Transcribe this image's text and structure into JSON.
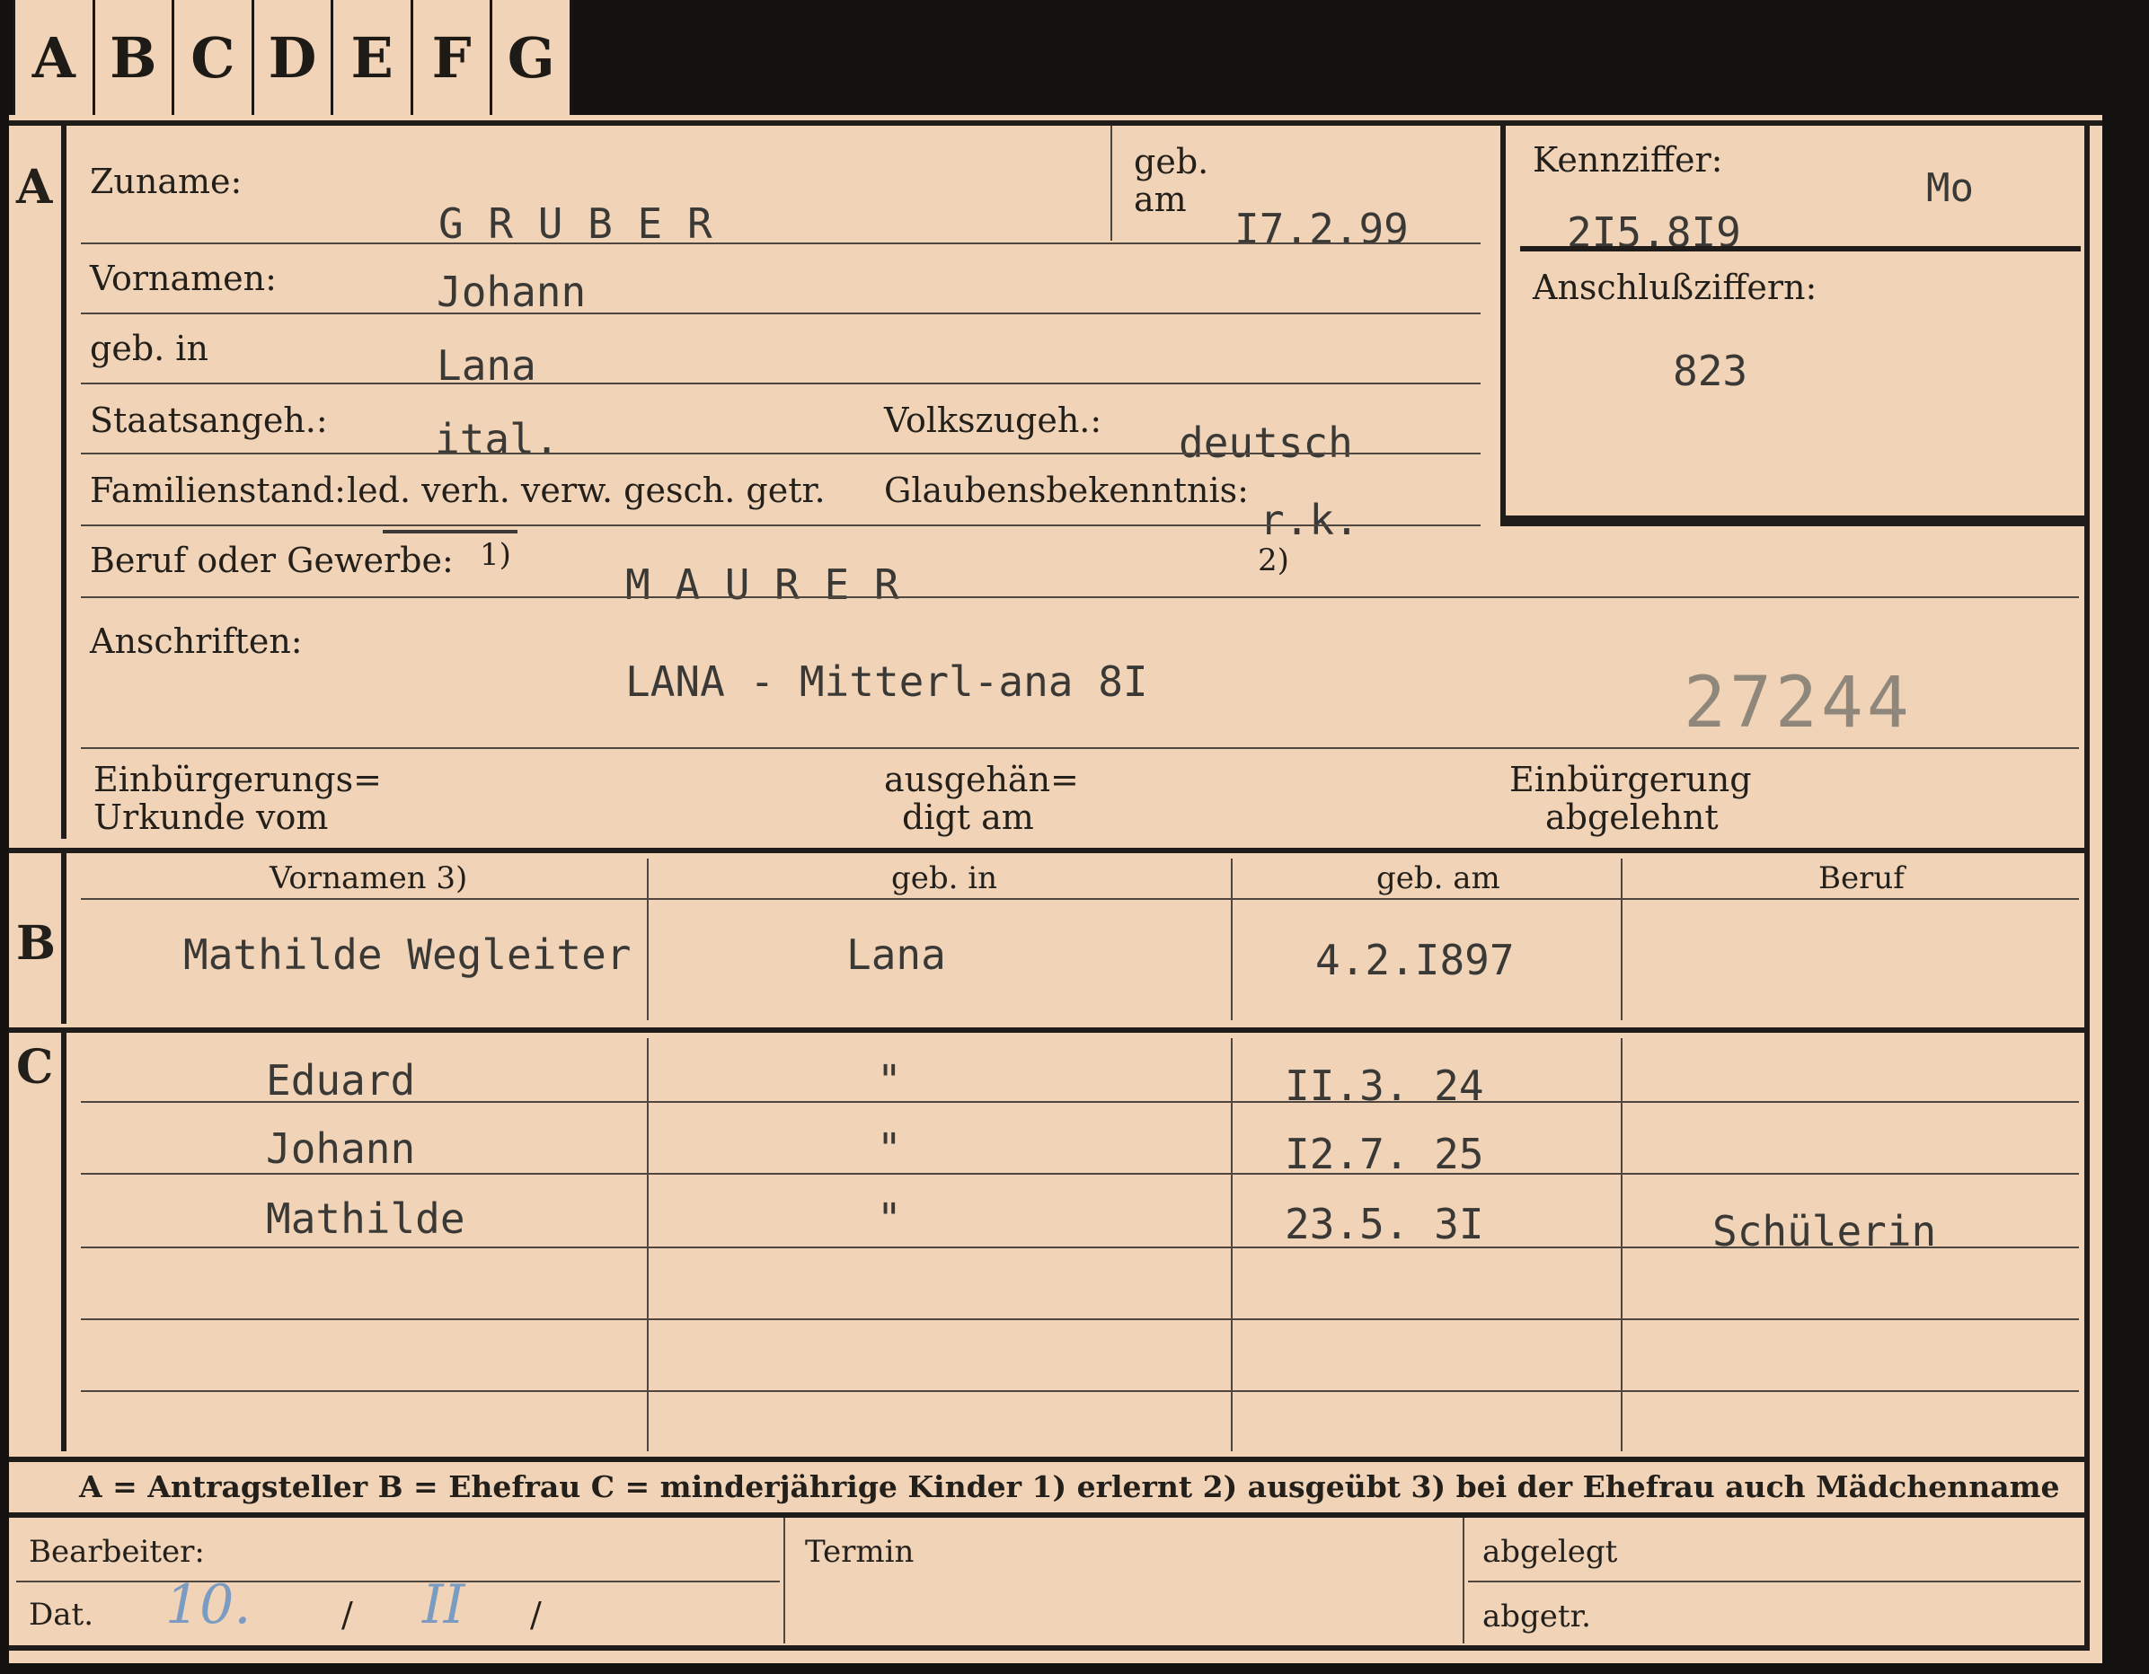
{
  "tabs": [
    "A",
    "B",
    "C",
    "D",
    "E",
    "F",
    "G"
  ],
  "section_a": {
    "marker": "A",
    "zuname_label": "Zuname:",
    "zuname_value": "G R U B E R",
    "geb_am_label_1": "geb.",
    "geb_am_label_2": "am",
    "geb_am_value": "I7.2.99",
    "vornamen_label": "Vornamen:",
    "vornamen_value": "Johann",
    "geb_in_label": "geb. in",
    "geb_in_value": "Lana",
    "staatsangeh_label": "Staatsangeh.:",
    "staatsangeh_value": "ital.",
    "volkszugeh_label": "Volkszugeh.:",
    "volkszugeh_value": "deutsch",
    "familienstand_label": "Familienstand:",
    "familienstand_options": "led. verh. verw. gesch. getr.",
    "glaubens_label": "Glaubensbekenntnis:",
    "glaubens_value": "r.k.",
    "beruf_label": "Beruf oder Gewerbe:",
    "beruf_note": "1)",
    "beruf_value": "M A U R E R",
    "beruf_note2": "2)",
    "anschriften_label": "Anschriften:",
    "anschriften_value": "LANA - Mitterl-ana  8I",
    "stamp_number": "27244",
    "einbuergerung_urkunde_1": "Einbürgerungs=",
    "einbuergerung_urkunde_2": "Urkunde vom",
    "ausgehaendigt_1": "ausgehän=",
    "ausgehaendigt_2": "digt am",
    "einbuergerung_abgelehnt_1": "Einbürgerung",
    "einbuergerung_abgelehnt_2": "abgelehnt"
  },
  "kennziffer": {
    "label": "Kennziffer:",
    "code": "Mo",
    "value": "2I5.8I9",
    "anschluss_label": "Anschlußziffern:",
    "anschluss_value": "823"
  },
  "section_b": {
    "marker": "B",
    "headers": [
      "Vornamen 3)",
      "geb. in",
      "geb. am",
      "Beruf"
    ],
    "row": [
      "Mathilde Wegleiter",
      "Lana",
      "4.2.I897",
      ""
    ]
  },
  "section_c": {
    "marker": "C",
    "rows": [
      [
        "Eduard",
        "\"",
        "II.3.  24",
        ""
      ],
      [
        "Johann",
        "\"",
        "I2.7.  25",
        ""
      ],
      [
        "Mathilde",
        "\"",
        "23.5.  3I",
        "Schülerin"
      ]
    ]
  },
  "legend": "A = Antragsteller   B = Ehefrau   C = minderjährige Kinder   1) erlernt   2) ausgeübt   3) bei der Ehefrau auch Mädchenname",
  "footer": {
    "bearbeiter_label": "Bearbeiter:",
    "dat_label": "Dat.",
    "dat_day": "10.",
    "dat_sep1": "/",
    "dat_month": "II",
    "dat_sep2": "/",
    "termin_label": "Termin",
    "abgelegt_label": "abgelegt",
    "abgetr_label": "abgetr."
  }
}
